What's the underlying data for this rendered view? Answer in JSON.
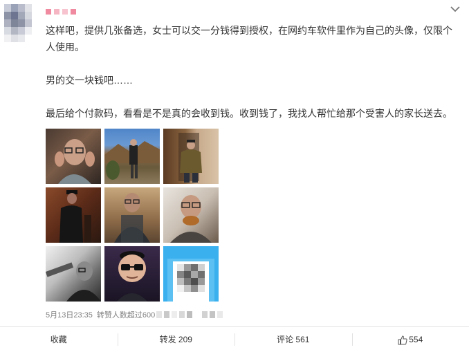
{
  "post": {
    "author_avatar": "blurred-avatar",
    "paragraphs": [
      "这样吧，提供几张备选，女士可以交一分钱得到授权，在网约车软件里作为自己的头像，仅限个人使用。",
      "男的交一块钱吧……",
      "最后给个付款码，看看是不是真的会收到钱。收到钱了，我找人帮忙给那个受害人的家长送去。"
    ],
    "images": [
      {
        "name": "photo-1"
      },
      {
        "name": "photo-2"
      },
      {
        "name": "photo-3"
      },
      {
        "name": "photo-4"
      },
      {
        "name": "photo-5"
      },
      {
        "name": "photo-6"
      },
      {
        "name": "photo-7"
      },
      {
        "name": "photo-8"
      },
      {
        "name": "photo-9-payment-code"
      }
    ],
    "meta": {
      "date": "5月13日23:35",
      "reposts_text": "转赞人数超过600"
    }
  },
  "actions": {
    "favorite": "收藏",
    "repost": "转发 209",
    "comment": "评论 561",
    "like": "554"
  },
  "colors": {
    "text": "#333333",
    "meta": "#808080",
    "qr_frame": "#3ab0ef",
    "name_blur": "#f08aa0"
  }
}
